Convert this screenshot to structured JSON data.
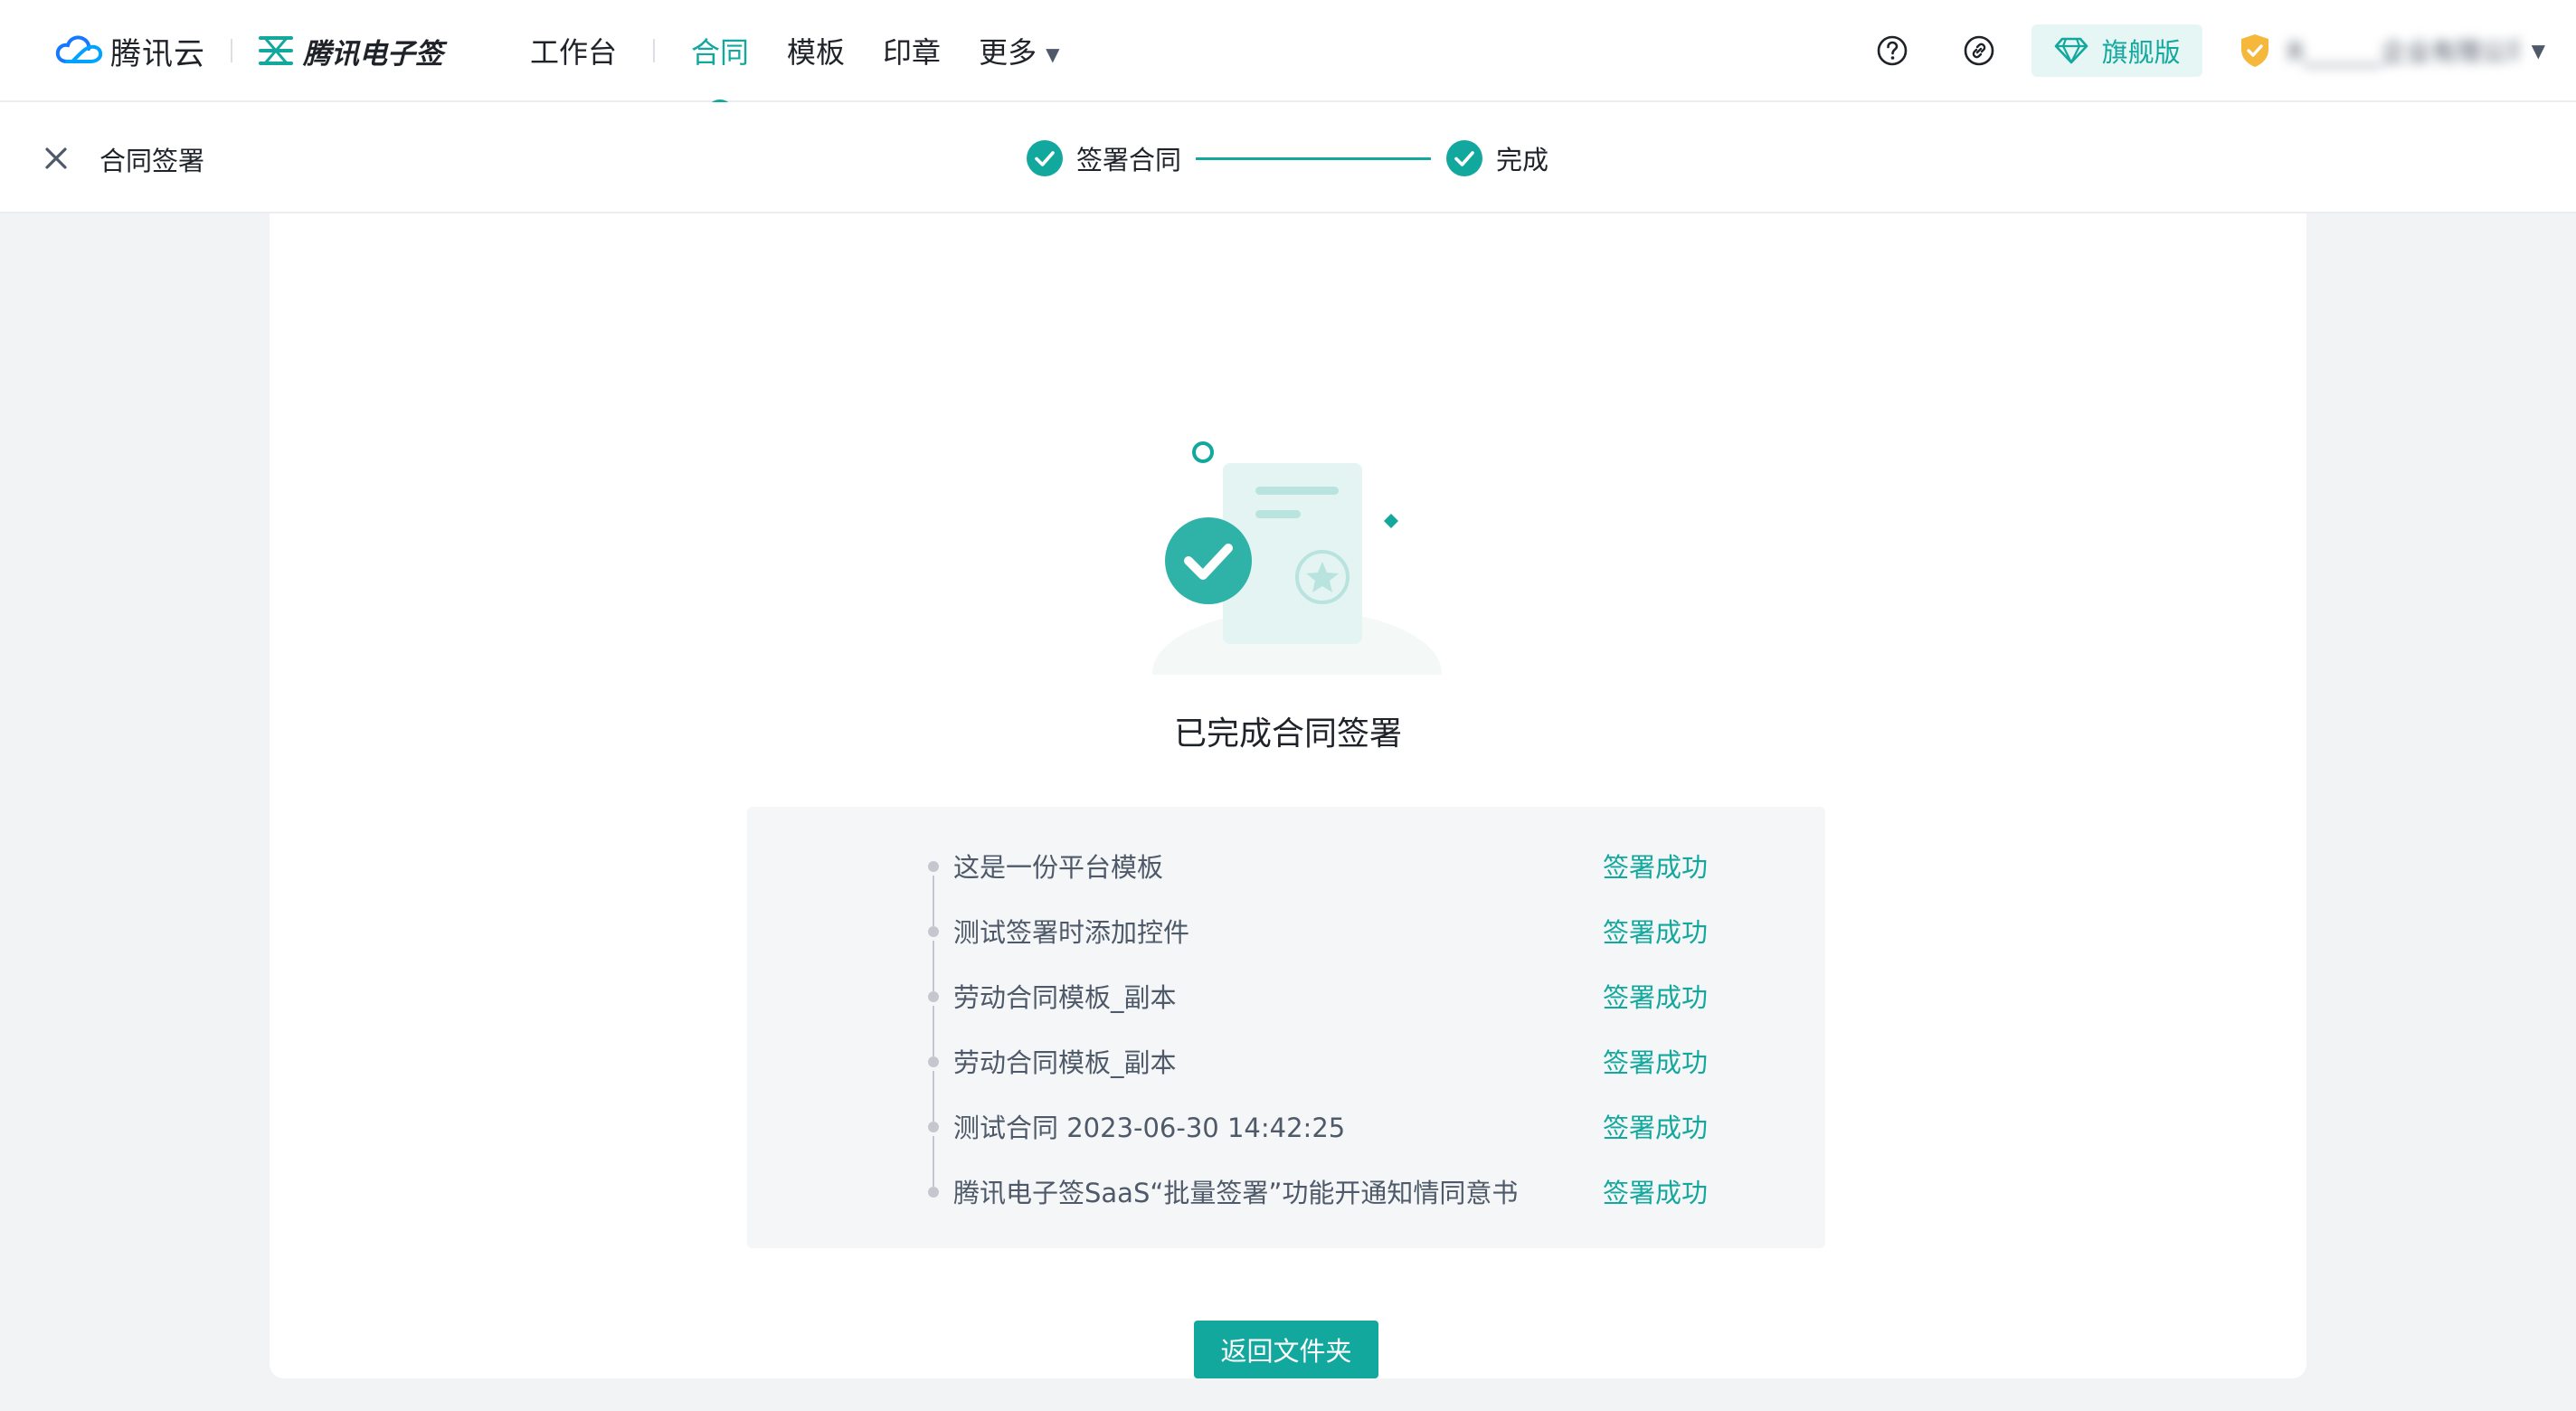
{
  "brand": {
    "cloud_name": "腾讯云",
    "product_name": "腾讯电子签"
  },
  "nav": {
    "workbench": "工作台",
    "contract": "合同",
    "template": "模板",
    "seal": "印章",
    "more": "更多",
    "active": "contract"
  },
  "header_right": {
    "icons": [
      "help-icon",
      "link-icon"
    ],
    "plan_label": "旗舰版",
    "org_name": "R______企业有限公司"
  },
  "subheader": {
    "title": "合同签署",
    "steps": [
      {
        "label": "签署合同",
        "status": "done"
      },
      {
        "label": "完成",
        "status": "done"
      }
    ]
  },
  "result": {
    "title": "已完成合同签署",
    "items": [
      {
        "name": "这是一份平台模板",
        "status": "签署成功"
      },
      {
        "name": "测试签署时添加控件",
        "status": "签署成功"
      },
      {
        "name": "劳动合同模板_副本",
        "status": "签署成功"
      },
      {
        "name": "劳动合同模板_副本",
        "status": "签署成功"
      },
      {
        "name": "测试合同 2023-06-30 14:42:25",
        "status": "签署成功"
      },
      {
        "name": "腾讯电子签SaaS“批量签署”功能开通知情同意书",
        "status": "签署成功"
      }
    ],
    "back_button": "返回文件夹"
  },
  "colors": {
    "accent": "#13a89e",
    "accent_light": "#e6f6f4",
    "shield": "#f5b83d",
    "cloud_blue": "#1677ff"
  }
}
